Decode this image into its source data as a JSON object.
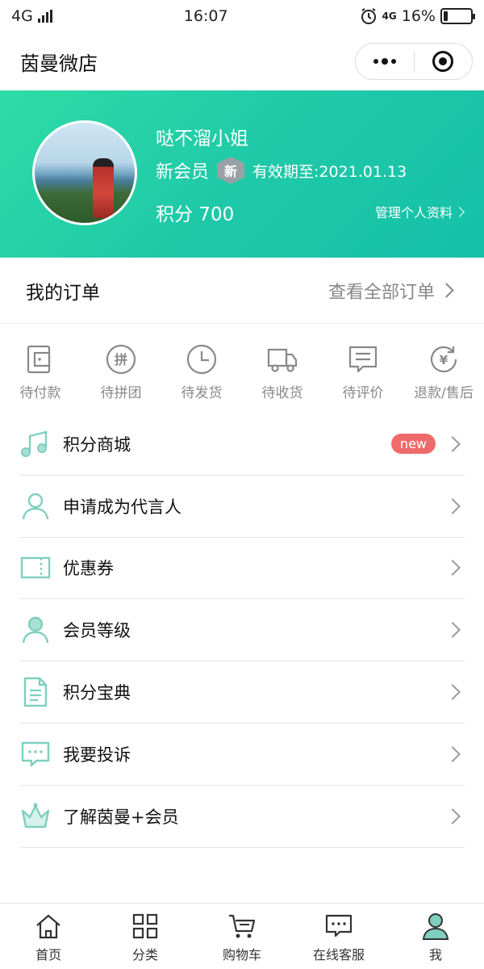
{
  "status_bar": {
    "network": "4G",
    "time": "16:07",
    "network2": "4G",
    "battery": "16%",
    "battery_level": 0.16
  },
  "nav": {
    "title": "茵曼微店"
  },
  "profile": {
    "username": "哒不溜小姐",
    "member_level": "新会员",
    "badge": "新",
    "expiry": "有效期至:2021.01.13",
    "points": "积分 700",
    "manage_link": "管理个人资料"
  },
  "orders": {
    "title": "我的订单",
    "view_all": "查看全部订单",
    "items": [
      {
        "label": "待付款",
        "icon": "wallet-icon"
      },
      {
        "label": "待拼团",
        "icon": "group-buy-icon"
      },
      {
        "label": "待发货",
        "icon": "clock-icon"
      },
      {
        "label": "待收货",
        "icon": "truck-icon"
      },
      {
        "label": "待评价",
        "icon": "comment-icon"
      },
      {
        "label": "退款/售后",
        "icon": "refund-icon"
      }
    ]
  },
  "menu": [
    {
      "label": "积分商城",
      "icon": "music-note-icon",
      "badge": "new"
    },
    {
      "label": "申请成为代言人",
      "icon": "person-icon"
    },
    {
      "label": "优惠券",
      "icon": "coupon-icon"
    },
    {
      "label": "会员等级",
      "icon": "member-icon"
    },
    {
      "label": "积分宝典",
      "icon": "document-icon"
    },
    {
      "label": "我要投诉",
      "icon": "complaint-icon"
    },
    {
      "label": "了解茵曼+会员",
      "icon": "crown-icon"
    }
  ],
  "tabs": [
    {
      "label": "首页",
      "icon": "home-icon"
    },
    {
      "label": "分类",
      "icon": "grid-icon"
    },
    {
      "label": "购物车",
      "icon": "cart-icon"
    },
    {
      "label": "在线客服",
      "icon": "chat-icon"
    },
    {
      "label": "我",
      "icon": "profile-icon",
      "active": true
    }
  ],
  "colors": {
    "accent": "#2fd5a6",
    "icon_teal": "#7fcfbf",
    "new_badge": "#ef6b6b",
    "gray_icon": "#888888"
  }
}
